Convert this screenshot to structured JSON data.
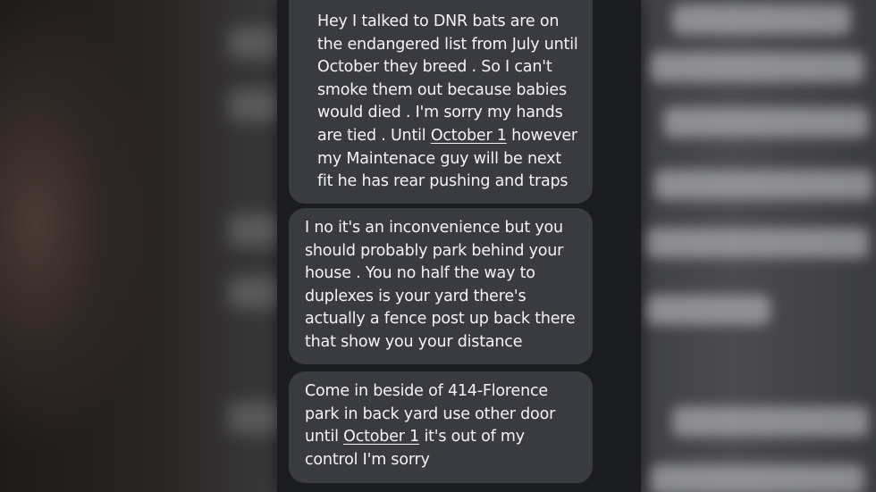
{
  "messages": [
    {
      "parts": [
        {
          "text": "Hey I talked to DNR bats are on the endangered list from July until October they breed . So I can't smoke them out because babies would died . I'm sorry my hands are tied . Until "
        },
        {
          "text": "October 1",
          "underline": true
        },
        {
          "text": " however my Maintenace guy will be next fit he has rear pushing and traps"
        }
      ]
    },
    {
      "parts": [
        {
          "text": "I no it's an inconvenience but you should probably park behind your house . You no half the way to duplexes is your yard there's actually a fence post up back there that show you your distance"
        }
      ]
    },
    {
      "parts": [
        {
          "text": "Come in beside of 414-Florence park in back yard use other door until "
        },
        {
          "text": "October 1",
          "underline": true
        },
        {
          "text": " it's out of my control I'm sorry"
        }
      ]
    }
  ],
  "colors": {
    "bubble": "#3a3b40",
    "screen": "#1b1c1f",
    "text": "#f4f4f4"
  }
}
